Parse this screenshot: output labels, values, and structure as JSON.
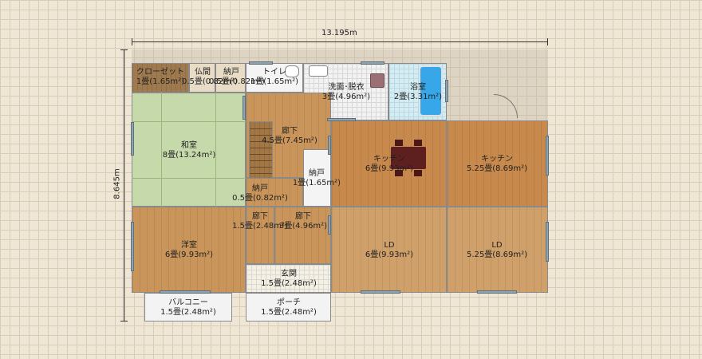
{
  "dimensions": {
    "width_label": "13.195m",
    "height_label": "8.645m"
  },
  "rooms": {
    "closet": {
      "name": "クローゼット",
      "area": "1畳(1.65m²)"
    },
    "butsuma": {
      "name": "仏間",
      "area": "0.5畳(0.82m²)"
    },
    "nando_top": {
      "name": "納戸",
      "area": "0.5畳(0.82m²)"
    },
    "toilet": {
      "name": "トイレ",
      "area": "1畳(1.65m²)"
    },
    "washroom": {
      "name": "洗面･脱衣",
      "area": "3畳(4.96m²)"
    },
    "bath": {
      "name": "浴室",
      "area": "2畳(3.31m²)"
    },
    "washitsu": {
      "name": "和室",
      "area": "8畳(13.24m²)"
    },
    "hallway_top": {
      "name": "廊下",
      "area": "4.5畳(7.45m²)"
    },
    "kitchen_left": {
      "name": "キッチン",
      "area": "6畳(9.93m²)"
    },
    "kitchen_right": {
      "name": "キッチン",
      "area": "5.25畳(8.69m²)"
    },
    "nando_mid": {
      "name": "納戸",
      "area": "1畳(1.65m²)"
    },
    "nando_small": {
      "name": "納戸",
      "area": "0.5畳(0.82m²)"
    },
    "hallway_left": {
      "name": "廊下",
      "area": "1.5畳(2.48m²)"
    },
    "hallway_right": {
      "name": "廊下",
      "area": "3畳(4.96m²)"
    },
    "youshitsu": {
      "name": "洋室",
      "area": "6畳(9.93m²)"
    },
    "ld_left": {
      "name": "LD",
      "area": "6畳(9.93m²)"
    },
    "ld_right": {
      "name": "LD",
      "area": "5.25畳(8.69m²)"
    },
    "genkan": {
      "name": "玄関",
      "area": "1.5畳(2.48m²)"
    },
    "balcony": {
      "name": "バルコニー",
      "area": "1.5畳(2.48m²)"
    },
    "porch": {
      "name": "ポーチ",
      "area": "1.5畳(2.48m²)"
    }
  }
}
